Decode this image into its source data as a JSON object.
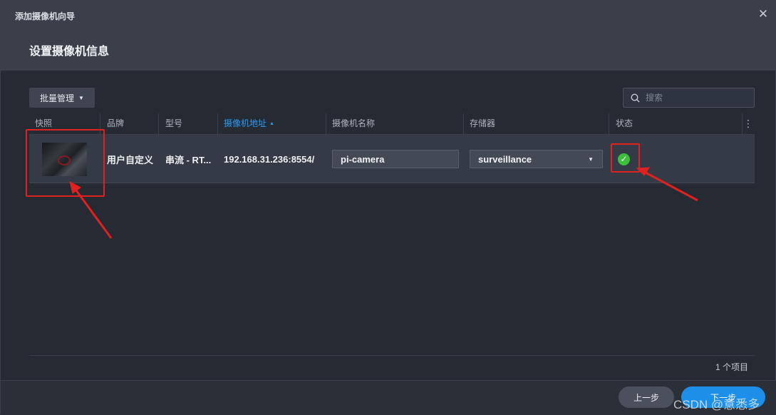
{
  "window": {
    "title": "添加摄像机向导",
    "close_glyph": "✕"
  },
  "step_title": "设置摄像机信息",
  "toolbar": {
    "batch_label": "批量管理",
    "search_placeholder": "搜索"
  },
  "table": {
    "columns": [
      "快照",
      "品牌",
      "型号",
      "摄像机地址",
      "摄像机名称",
      "存储器",
      "状态"
    ],
    "rows": [
      {
        "brand": "用户自定义",
        "model": "串流 - RT...",
        "address": "192.168.31.236:8554/",
        "name": "pi-camera",
        "storage": "surveillance",
        "status": "ok"
      }
    ],
    "count_label": "1 个项目"
  },
  "footer": {
    "prev_label": "上一步",
    "next_label": "下一步"
  },
  "watermark": "CSDN @意悉多",
  "colors": {
    "accent": "#1e8fe8",
    "status_ok": "#3bbf3b",
    "annotation": "#e0211f"
  }
}
